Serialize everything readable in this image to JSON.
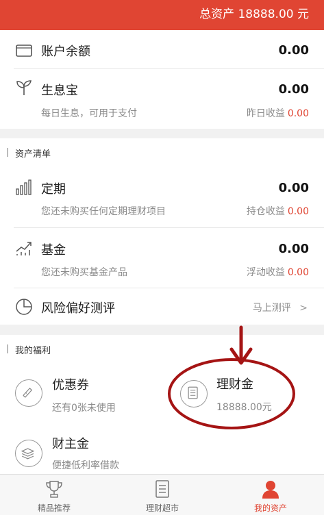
{
  "header": {
    "total_assets": "总资产 18888.00 元"
  },
  "account": {
    "balance": {
      "label": "账户余额",
      "value": "0.00",
      "icon": "wallet-icon"
    },
    "shengxibao": {
      "label": "生息宝",
      "value": "0.00",
      "desc": "每日生息，可用于支付",
      "yesterday_label": "昨日收益",
      "yesterday_value": "0.00",
      "icon": "sprout-icon"
    }
  },
  "asset_list": {
    "section_title": "资产清单",
    "fixed": {
      "label": "定期",
      "value": "0.00",
      "desc": "您还未购买任何定期理财项目",
      "holding_label": "持仓收益",
      "holding_value": "0.00",
      "icon": "bar-chart-icon"
    },
    "fund": {
      "label": "基金",
      "value": "0.00",
      "desc": "您还未购买基金产品",
      "float_label": "浮动收益",
      "float_value": "0.00",
      "icon": "trend-chart-icon"
    },
    "risk": {
      "label": "风险偏好测评",
      "action": "马上测评",
      "icon": "pie-chart-icon"
    }
  },
  "benefits": {
    "section_title": "我的福利",
    "coupon": {
      "title": "优惠券",
      "desc": "还有0张未使用",
      "icon": "ticket-icon"
    },
    "finance_gold": {
      "title": "理财金",
      "desc": "18888.00元",
      "icon": "document-icon"
    },
    "caizhujin": {
      "title": "财主金",
      "desc": "便捷低利率借款",
      "icon": "coin-stack-icon"
    }
  },
  "tabs": [
    {
      "label": "精品推荐",
      "icon": "trophy-icon",
      "active": false
    },
    {
      "label": "理财超市",
      "icon": "list-icon",
      "active": false
    },
    {
      "label": "我的资产",
      "icon": "user-icon",
      "active": true
    }
  ],
  "colors": {
    "accent": "#e04533",
    "annotation": "#a51414"
  }
}
